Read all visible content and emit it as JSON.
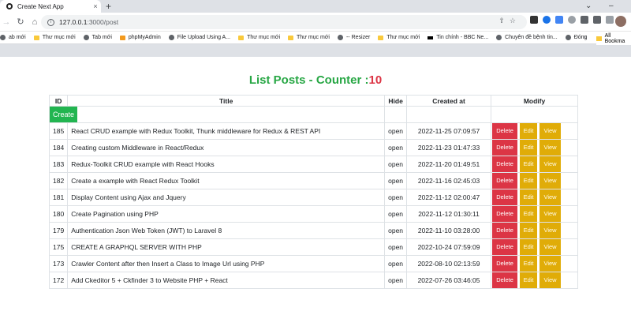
{
  "browser": {
    "tab_title": "Create Next App",
    "tab_close": "×",
    "new_tab": "+",
    "win_chevron": "⌄",
    "win_minimize": "–",
    "url_host": "127.0.0.1",
    "url_path": ":3000/post",
    "omnibox_icons": "⇪☆",
    "bookmarks": [
      {
        "label": "ab mới",
        "icon": "globe"
      },
      {
        "label": "Thư mục mới",
        "icon": "folder"
      },
      {
        "label": "Tab mới",
        "icon": "globe"
      },
      {
        "label": "phpMyAdmin",
        "icon": "php"
      },
      {
        "label": "File Upload Using A...",
        "icon": "globe"
      },
      {
        "label": "Thư mục mới",
        "icon": "folder"
      },
      {
        "label": "Thư mục mới",
        "icon": "folder"
      },
      {
        "label": "-- Resizer",
        "icon": "globe"
      },
      {
        "label": "Thư mục mới",
        "icon": "folder"
      },
      {
        "label": "Tin chính - BBC Ne...",
        "icon": "bbc"
      },
      {
        "label": "Chuyên đề bệnh tin...",
        "icon": "globe"
      },
      {
        "label": "Đóng",
        "icon": "globe"
      }
    ],
    "bookmarks_more": "»",
    "all_bookmarks": "All Bookma"
  },
  "page": {
    "heading_prefix": "List Posts - Counter :",
    "counter": "10",
    "columns": [
      "ID",
      "Title",
      "Hide",
      "Created at",
      "Modify"
    ],
    "create_label": "Create",
    "delete_label": "Delete",
    "edit_label": "Edit",
    "view_label": "View",
    "colors": {
      "heading": "#28a745",
      "counter": "#dc3545",
      "delete": "#dc3545",
      "edit": "#e0ac08",
      "create": "#22b550"
    }
  },
  "posts": [
    {
      "id": "185",
      "title": "React CRUD example with Redux Toolkit, Thunk middleware for Redux & REST API",
      "hide": "open",
      "created_at": "2022-11-25 07:09:57"
    },
    {
      "id": "184",
      "title": "Creating custom Middleware in React/Redux",
      "hide": "open",
      "created_at": "2022-11-23 01:47:33"
    },
    {
      "id": "183",
      "title": "Redux-Toolkit CRUD example with React Hooks",
      "hide": "open",
      "created_at": "2022-11-20 01:49:51"
    },
    {
      "id": "182",
      "title": "Create a example with React Redux Toolkit",
      "hide": "open",
      "created_at": "2022-11-16 02:45:03"
    },
    {
      "id": "181",
      "title": "Display Content using Ajax and Jquery",
      "hide": "open",
      "created_at": "2022-11-12 02:00:47"
    },
    {
      "id": "180",
      "title": "Create Pagination using PHP",
      "hide": "open",
      "created_at": "2022-11-12 01:30:11"
    },
    {
      "id": "179",
      "title": "Authentication Json Web Token (JWT) to Laravel 8",
      "hide": "open",
      "created_at": "2022-11-10 03:28:00"
    },
    {
      "id": "175",
      "title": "CREATE A GRAPHQL SERVER WITH PHP",
      "hide": "open",
      "created_at": "2022-10-24 07:59:09"
    },
    {
      "id": "173",
      "title": "Crawler Content after then Insert a Class to Image Url using PHP",
      "hide": "open",
      "created_at": "2022-08-10 02:13:59"
    },
    {
      "id": "172",
      "title": "Add Ckeditor 5 + Ckfinder 3 to Website PHP + React",
      "hide": "open",
      "created_at": "2022-07-26 03:46:05"
    }
  ]
}
